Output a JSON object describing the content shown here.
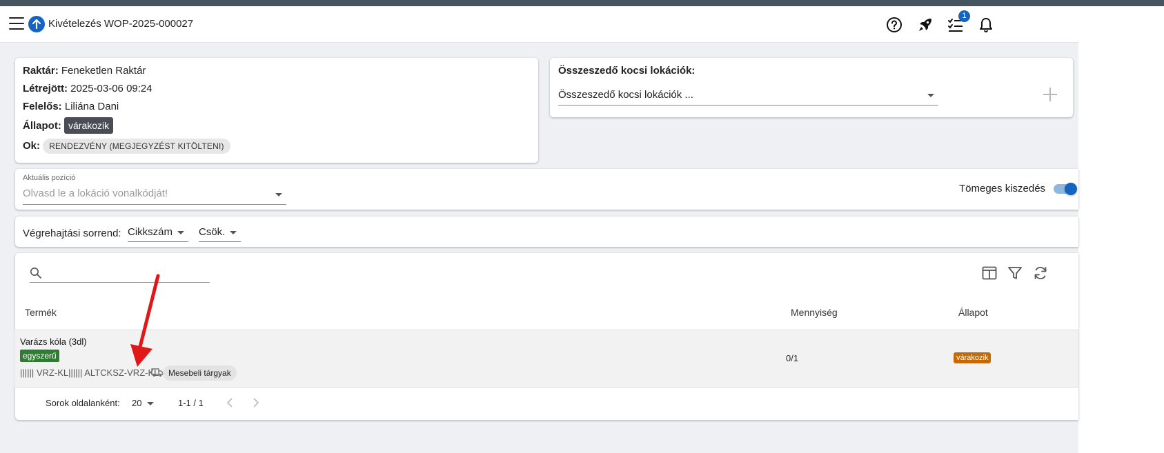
{
  "header": {
    "title": "Kivételezés WOP-2025-000027",
    "notification_count": "1",
    "icons": [
      "menu-icon",
      "arrow-up-icon",
      "help-icon",
      "rocket-icon",
      "task-list-icon",
      "bell-icon"
    ],
    "accent_color": "#1565c0"
  },
  "info": {
    "warehouse_label": "Raktár:",
    "warehouse_value": "Feneketlen Raktár",
    "created_label": "Létrejött:",
    "created_value": "2025-03-06 09:24",
    "responsible_label": "Felelős:",
    "responsible_value": "Liliána Dani",
    "status_label": "Állapot:",
    "status_value": "várakozik",
    "reason_label": "Ok:",
    "reason_value": "RENDEZVÉNY (MEGJEGYZÉST KITÖLTENI)"
  },
  "cart": {
    "title": "Összeszedő kocsi lokációk:",
    "select_text": "Összeszedő kocsi lokációk ..."
  },
  "position": {
    "label": "Aktuális pozíció",
    "placeholder": "Olvasd le a lokáció vonalkódját!",
    "bulk_label": "Tömeges kiszedés",
    "bulk_enabled": true
  },
  "order": {
    "label": "Végrehajtási sorrend:",
    "field_value": "Cikkszám",
    "direction_value": "Csök."
  },
  "table": {
    "search_value": "",
    "columns": {
      "product": "Termék",
      "quantity": "Mennyiség",
      "status": "Állapot"
    },
    "rows": [
      {
        "name": "Varázs kóla (3dl)",
        "type_chip": "egyszerű",
        "barcodes": "|||||| VRZ-KL|||||| ALTCKSZ-VRZ-KL",
        "category_chip": "Mesebeli tárgyak",
        "quantity": "0/1",
        "status": "várakozik"
      }
    ],
    "pagination": {
      "rows_label": "Sorok oldalanként:",
      "rows_value": "20",
      "range": "1-1 / 1"
    }
  }
}
